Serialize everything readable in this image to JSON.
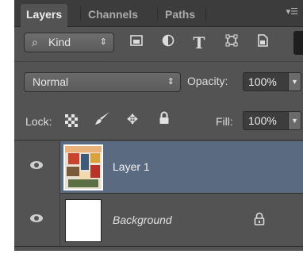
{
  "tabs": [
    {
      "label": "Layers",
      "active": true
    },
    {
      "label": "Channels",
      "active": false
    },
    {
      "label": "Paths",
      "active": false
    }
  ],
  "panel_menu_icon": "panel-menu-icon",
  "filter": {
    "kind_label": "Kind",
    "kind_icon": "search-icon",
    "kind_arrow": "⇕",
    "buttons": [
      {
        "icon": "image-filter-icon",
        "glyph": "▣"
      },
      {
        "icon": "adjustment-filter-icon",
        "glyph": "◐"
      },
      {
        "icon": "type-filter-icon",
        "glyph": "T"
      },
      {
        "icon": "shape-filter-icon",
        "glyph": "⌑"
      },
      {
        "icon": "smart-object-filter-icon",
        "glyph": "🗋"
      }
    ]
  },
  "blend": {
    "mode": "Normal",
    "arrow": "⇕",
    "opacity_label": "Opacity:",
    "opacity_value": "100%"
  },
  "lock": {
    "label": "Lock:",
    "icons": [
      {
        "icon": "lock-transparent-pixels-icon",
        "glyph": ""
      },
      {
        "icon": "lock-image-pixels-icon",
        "glyph": "🖌"
      },
      {
        "icon": "lock-position-icon",
        "glyph": "✥"
      },
      {
        "icon": "lock-all-icon",
        "glyph": "🔒"
      }
    ],
    "fill_label": "Fill:",
    "fill_value": "100%"
  },
  "layers": [
    {
      "name": "Layer 1",
      "selected": true,
      "visible": true,
      "locked": false,
      "thumb": "artwork"
    },
    {
      "name": "Background",
      "selected": false,
      "visible": true,
      "locked": true,
      "thumb": "white"
    }
  ],
  "colors": {
    "panel_bg": "#535353",
    "tabbar_bg": "#3c3c3c",
    "selected_row": "#5a6a80"
  }
}
